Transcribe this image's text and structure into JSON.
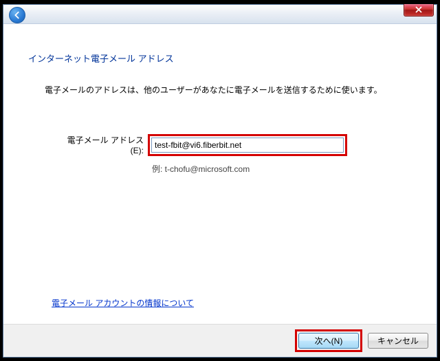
{
  "heading": "インターネット電子メール アドレス",
  "description": "電子メールのアドレスは、他のユーザーがあなたに電子メールを送信するために使います。",
  "form": {
    "email_label": "電子メール アドレス(E):",
    "email_value": "test-fbit@vi6.fiberbit.net",
    "example": "例: t-chofu@microsoft.com"
  },
  "link_text": "電子メール アカウントの情報について",
  "buttons": {
    "next": "次へ(N)",
    "cancel": "キャンセル"
  }
}
